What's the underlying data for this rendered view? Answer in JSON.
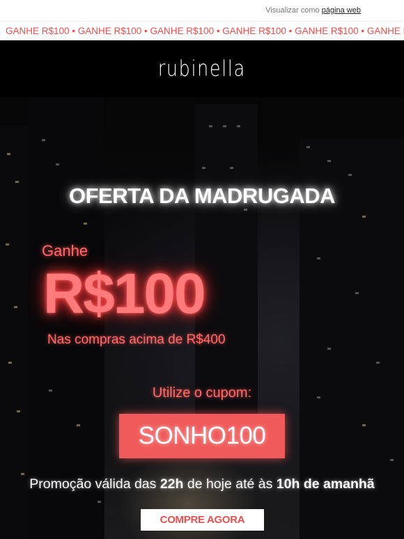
{
  "topbar": {
    "view_prefix": "Visualizar como",
    "view_link": "página web"
  },
  "ticker": {
    "text": "GANHE R$100 • GANHE R$100 • GANHE R$100 • GANHE R$100 • GANHE R$100 • GANHE R$100 • GANHE R$100"
  },
  "brand": {
    "logo": "rubinella"
  },
  "hero": {
    "headline": "OFERTA DA MADRUGADA",
    "ganhe": "Ganhe",
    "amount": "R$100",
    "condition": "Nas compras acima de R$400",
    "coupon_label": "Utilize o cupom:",
    "coupon_code": "SONHO100",
    "validity_part1": "Promoção válida das ",
    "validity_start": "22h",
    "validity_part2": " de hoje até às ",
    "validity_end": "10h de amanhã",
    "cta": "COMPRE AGORA"
  },
  "colors": {
    "accent": "#f05a5a",
    "accent_text": "#ff6a6a",
    "background": "#000000"
  }
}
